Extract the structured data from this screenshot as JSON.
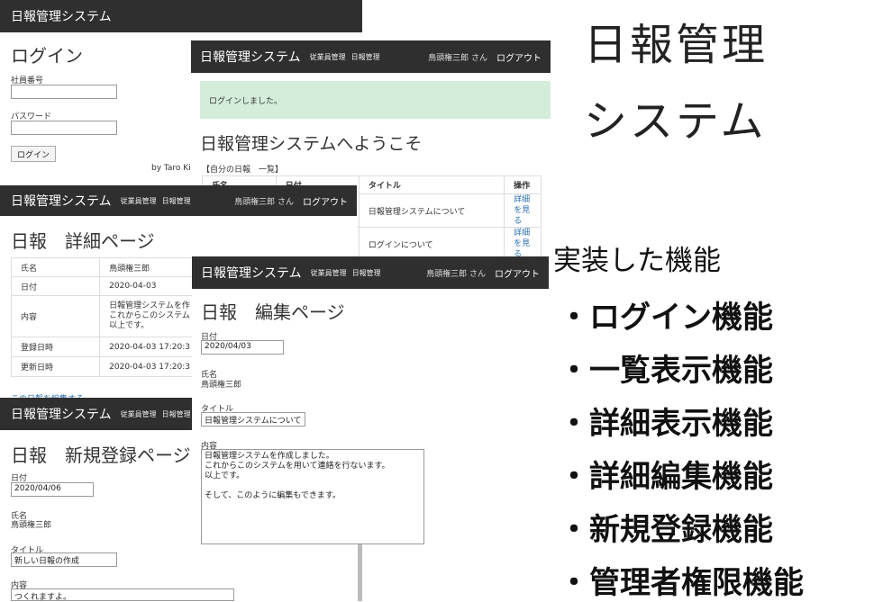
{
  "login": {
    "app_name": "日報管理システム",
    "title": "ログイン",
    "employee_label": "社員番号",
    "password_label": "パスワード",
    "button": "ログイン",
    "footer": "by Taro Kir"
  },
  "top": {
    "brand": "日報管理システム",
    "nav_employees": "従業員管理",
    "nav_reports": "日報管理",
    "user": "鳥頭権三郎 さん",
    "logout": "ログアウト",
    "flash": "ログインしました。",
    "welcome": "日報管理システムへようこそ",
    "list_heading": "【自分の日報　一覧】",
    "columns": [
      "氏名",
      "日付",
      "タイトル",
      "操作"
    ],
    "rows": [
      {
        "title": "日報管理システムについて",
        "action": "詳細を見る"
      },
      {
        "title": "ログインについて",
        "action": "詳細を見る"
      }
    ]
  },
  "detail": {
    "brand": "日報管理システム",
    "nav_employees": "従業員管理",
    "nav_reports": "日報管理",
    "user": "鳥頭権三郎 さん",
    "logout": "ログアウト",
    "title": "日報　詳細ページ",
    "rows": [
      {
        "label": "氏名",
        "value": "鳥頭権三郎"
      },
      {
        "label": "日付",
        "value": "2020-04-03"
      },
      {
        "label": "内容",
        "value": "日報管理システムを作\nこれからこのシステム\n以上です。"
      },
      {
        "label": "登録日時",
        "value": "2020-04-03 17:20:3"
      },
      {
        "label": "更新日時",
        "value": "2020-04-03 17:20:3"
      }
    ],
    "edit_link": "この日報を編集する"
  },
  "edit": {
    "brand": "日報管理システム",
    "nav_employees": "従業員管理",
    "nav_reports": "日報管理",
    "user": "鳥頭権三郎 さん",
    "logout": "ログアウト",
    "title": "日報　編集ページ",
    "date_label": "日付",
    "date_value": "2020/04/03",
    "name_label": "氏名",
    "name_value": "鳥頭権三郎",
    "title_label": "タイトル",
    "title_value": "日報管理システムについて",
    "content_label": "内容",
    "content_lines": [
      "日報管理システムを作成しました。",
      "これからこのシステムを用いて連絡を行ないます。",
      "以上です。",
      "",
      "そして、このように編集もできます。"
    ]
  },
  "new": {
    "brand": "日報管理システム",
    "nav_employees": "従業員管理",
    "nav_reports": "日報管理",
    "title": "日報　新規登録ページ",
    "date_label": "日付",
    "date_value": "2020/04/06",
    "name_label": "氏名",
    "name_value": "鳥頭権三郎",
    "title_label": "タイトル",
    "title_value": "新しい日報の作成",
    "content_label": "内容",
    "content_value": "つくれますよ。"
  },
  "slide": {
    "title_line1": "日報管理",
    "title_line2": "システム",
    "features_heading": "実装した機能",
    "features": [
      "・ログイン機能",
      "・一覧表示機能",
      "・詳細表示機能",
      "・詳細編集機能",
      "・新規登録機能",
      "・管理者権限機能"
    ]
  }
}
